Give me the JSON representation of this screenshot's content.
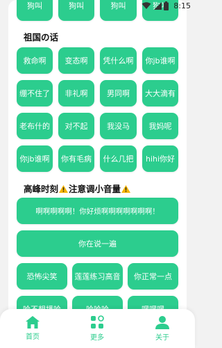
{
  "status_bar": {
    "time": "8:15"
  },
  "top_partial_row": [
    "狗叫",
    "狗叫",
    "狗叫",
    "狗叫"
  ],
  "section1": {
    "title": "祖国の话",
    "buttons": [
      "救命啊",
      "变态啊",
      "凭什么啊",
      "你jb谁啊",
      "绷不住了",
      "非礼啊",
      "男同啊",
      "大大滴有",
      "老布什的",
      "对不起",
      "我没马",
      "我妈呢",
      "你jb谁啊",
      "你有毛病",
      "什么几把",
      "hihi你好"
    ]
  },
  "section2": {
    "title_text": "高峰时刻",
    "title_text2": "注意调小音量",
    "wide_buttons": [
      "啊啊啊啊啊！你好烦啊啊啊啊啊啊啊！",
      "你在说一遍"
    ],
    "buttons": [
      "恐怖尖笑",
      "莲莲练习高音",
      "你正常一点",
      "哈不想播哈",
      "哈哈哈",
      "嘿嘿嘿"
    ]
  },
  "tabbar": {
    "items": [
      {
        "label": "首页",
        "icon": "home-icon"
      },
      {
        "label": "更多",
        "icon": "grid-icon"
      },
      {
        "label": "关于",
        "icon": "user-icon"
      }
    ]
  },
  "colors": {
    "accent": "#2ccd8e",
    "warning": "#f5b400"
  }
}
